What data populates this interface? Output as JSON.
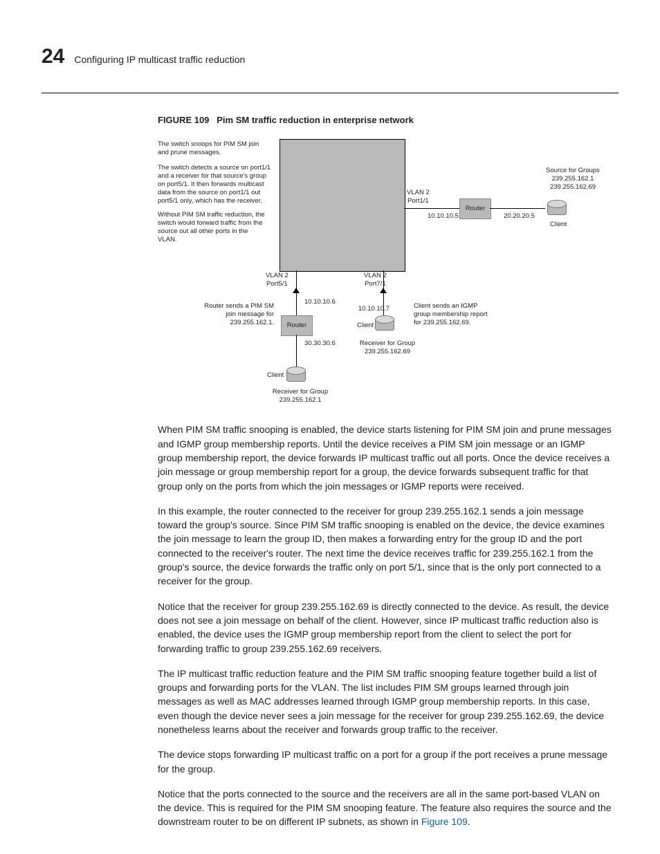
{
  "header": {
    "chapter_number": "24",
    "chapter_title": "Configuring IP multicast traffic reduction"
  },
  "figure": {
    "label": "FIGURE 109",
    "title": "Pim SM traffic reduction in enterprise network",
    "notes": {
      "snoop": "The switch snoops for PIM SM join and prune messages.",
      "detect": "The switch detects a source on port1/1 and a receiver for that source's group on port5/1. It then forwards multicast data from the source on port1/1 out port5/1 only, which has the receiver.",
      "without": "Without PIM SM traffic reduction, the switch would forward traffic from the source out all other ports in the VLAN.",
      "router_sends": "Router sends a PIM SM join message for 239.255.162.1.",
      "client_sends": "Client sends an IGMP group membership report for 239.255.162.69.",
      "source_for": "Source for Groups 239.255.162.1 239.255.162.69",
      "receiver_69": "Receiver for Group 239.255.162.69",
      "receiver_1": "Receiver for Group 239.255.162.1"
    },
    "labels": {
      "vlan2_p11": "VLAN 2\nPort1/1",
      "vlan2_p51": "VLAN 2\nPort5/1",
      "vlan2_p71": "VLAN 2\nPort7/1",
      "router": "Router",
      "client": "Client",
      "ip_10_5": "10.10.10.5",
      "ip_20_5": "20.20.20.5",
      "ip_10_6": "10.10.10.6",
      "ip_10_7": "10.10.10.7",
      "ip_30_6": "30.30.30.6"
    }
  },
  "body": {
    "p1": "When PIM SM traffic snooping is enabled, the device starts listening for PIM SM join and prune messages and IGMP group membership reports.  Until the device receives a PIM SM join message or an IGMP group membership report, the device forwards IP multicast traffic out all ports.  Once the device receives a join message or group membership report for a group, the device forwards subsequent traffic for that group only on the ports from which the join messages or IGMP reports were received.",
    "p2": "In this example, the router connected to the receiver for group 239.255.162.1 sends a join message toward the group's source.  Since PIM SM traffic snooping is enabled on the device, the device examines the join message to learn the group ID, then makes a forwarding entry for the group ID and the port connected to the receiver's router.  The next time the device receives traffic for 239.255.162.1 from the group's source, the device forwards the traffic only on port 5/1, since that is the only port connected to a receiver for the group.",
    "p3": "Notice that the receiver for group 239.255.162.69 is directly connected to the device.  As result, the device does not see a join message on behalf of the client.  However, since IP multicast traffic reduction also is enabled, the device uses the IGMP group membership report from the client to select the port for forwarding traffic to group 239.255.162.69 receivers.",
    "p4": "The IP multicast traffic reduction feature and the PIM SM traffic snooping feature together build a list of groups and forwarding ports for the VLAN.  The list includes PIM SM groups learned through join messages as well as MAC addresses learned through IGMP group membership reports.  In this case, even though the device never sees a join message for the receiver for group 239.255.162.69, the device nonetheless learns about the receiver and forwards group traffic to the receiver.",
    "p5": "The device stops forwarding IP multicast traffic on a port for a group if the port receives a prune message for the group.",
    "p6_a": "Notice that the ports connected to the source and the receivers are all in the same port-based VLAN on the device.  This is required for the PIM SM snooping feature.  The feature also requires the source and the downstream router to be on different IP subnets, as shown in ",
    "p6_link": "Figure 109",
    "p6_b": "."
  }
}
